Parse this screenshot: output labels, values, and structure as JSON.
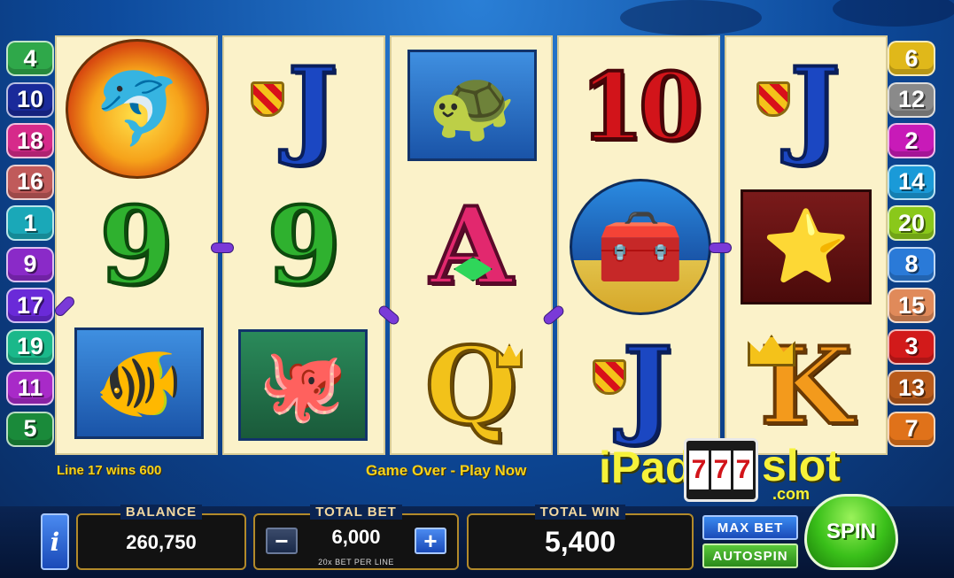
{
  "colors": {
    "badge_green": "#2fa84a",
    "badge_navy": "#1a2a9a",
    "badge_pink": "#d62a8a",
    "badge_rose": "#c05a5a",
    "badge_teal": "#1aa8b8",
    "badge_purple": "#8a2ac8",
    "badge_lime": "#8ac81a",
    "badge_blue": "#2a7ad8",
    "badge_peach": "#e08a5a",
    "badge_red": "#d21a1a",
    "badge_brown": "#b85a1a",
    "badge_orange": "#e0721a",
    "badge_grey": "#8a8a8a",
    "badge_magenta": "#c81ab8",
    "status_text": "#f6d21a",
    "spin": "#3ac01a"
  },
  "left_lines": [
    {
      "label": "4",
      "color": "#2fa84a"
    },
    {
      "label": "10",
      "color": "#1a2a9a"
    },
    {
      "label": "18",
      "color": "#d62a8a"
    },
    {
      "label": "16",
      "color": "#c05a5a"
    },
    {
      "label": "1",
      "color": "#1aa8b8"
    },
    {
      "label": "9",
      "color": "#8a2ac8"
    },
    {
      "label": "17",
      "color": "#6a2ad8"
    },
    {
      "label": "19",
      "color": "#1ab88a"
    },
    {
      "label": "11",
      "color": "#a82ac8"
    },
    {
      "label": "5",
      "color": "#1a8a3a"
    }
  ],
  "right_lines": [
    {
      "label": "6",
      "color": "#e0b81a"
    },
    {
      "label": "12",
      "color": "#8a8a8a"
    },
    {
      "label": "2",
      "color": "#c81ab8"
    },
    {
      "label": "14",
      "color": "#1a9ad8"
    },
    {
      "label": "20",
      "color": "#8ac81a"
    },
    {
      "label": "8",
      "color": "#2a7ad8"
    },
    {
      "label": "15",
      "color": "#e08a5a"
    },
    {
      "label": "3",
      "color": "#d21a1a"
    },
    {
      "label": "13",
      "color": "#b85a1a"
    },
    {
      "label": "7",
      "color": "#e0721a"
    }
  ],
  "reels": [
    [
      {
        "symbol": "dolphin-icon"
      },
      {
        "symbol": "nine",
        "text": "9"
      },
      {
        "symbol": "fish-icon"
      }
    ],
    [
      {
        "symbol": "jack",
        "text": "J"
      },
      {
        "symbol": "nine",
        "text": "9"
      },
      {
        "symbol": "octopus-icon"
      }
    ],
    [
      {
        "symbol": "turtle-icon"
      },
      {
        "symbol": "ace",
        "text": "A"
      },
      {
        "symbol": "queen",
        "text": "Q"
      }
    ],
    [
      {
        "symbol": "ten",
        "text": "10"
      },
      {
        "symbol": "treasure-chest-icon"
      },
      {
        "symbol": "jack",
        "text": "J"
      }
    ],
    [
      {
        "symbol": "jack",
        "text": "J"
      },
      {
        "symbol": "starfish-icon"
      },
      {
        "symbol": "king",
        "text": "K"
      }
    ]
  ],
  "status": {
    "win_line": "Line 17 wins 600",
    "message": "Game Over - Play Now"
  },
  "watermark": {
    "left": "iPad",
    "reels": [
      "7",
      "7",
      "7"
    ],
    "right": "slot",
    "suffix": ".com"
  },
  "bottom": {
    "info_label": "i",
    "balance_title": "BALANCE",
    "balance_value": "260,750",
    "total_bet_title": "TOTAL BET",
    "total_bet_value": "6,000",
    "minus_label": "−",
    "plus_label": "+",
    "bet_caption": "20x BET PER LINE",
    "total_win_title": "TOTAL WIN",
    "total_win_value": "5,400",
    "max_bet_label": "MAX BET",
    "autospin_label": "AUTOSPIN",
    "spin_label": "SPIN"
  }
}
